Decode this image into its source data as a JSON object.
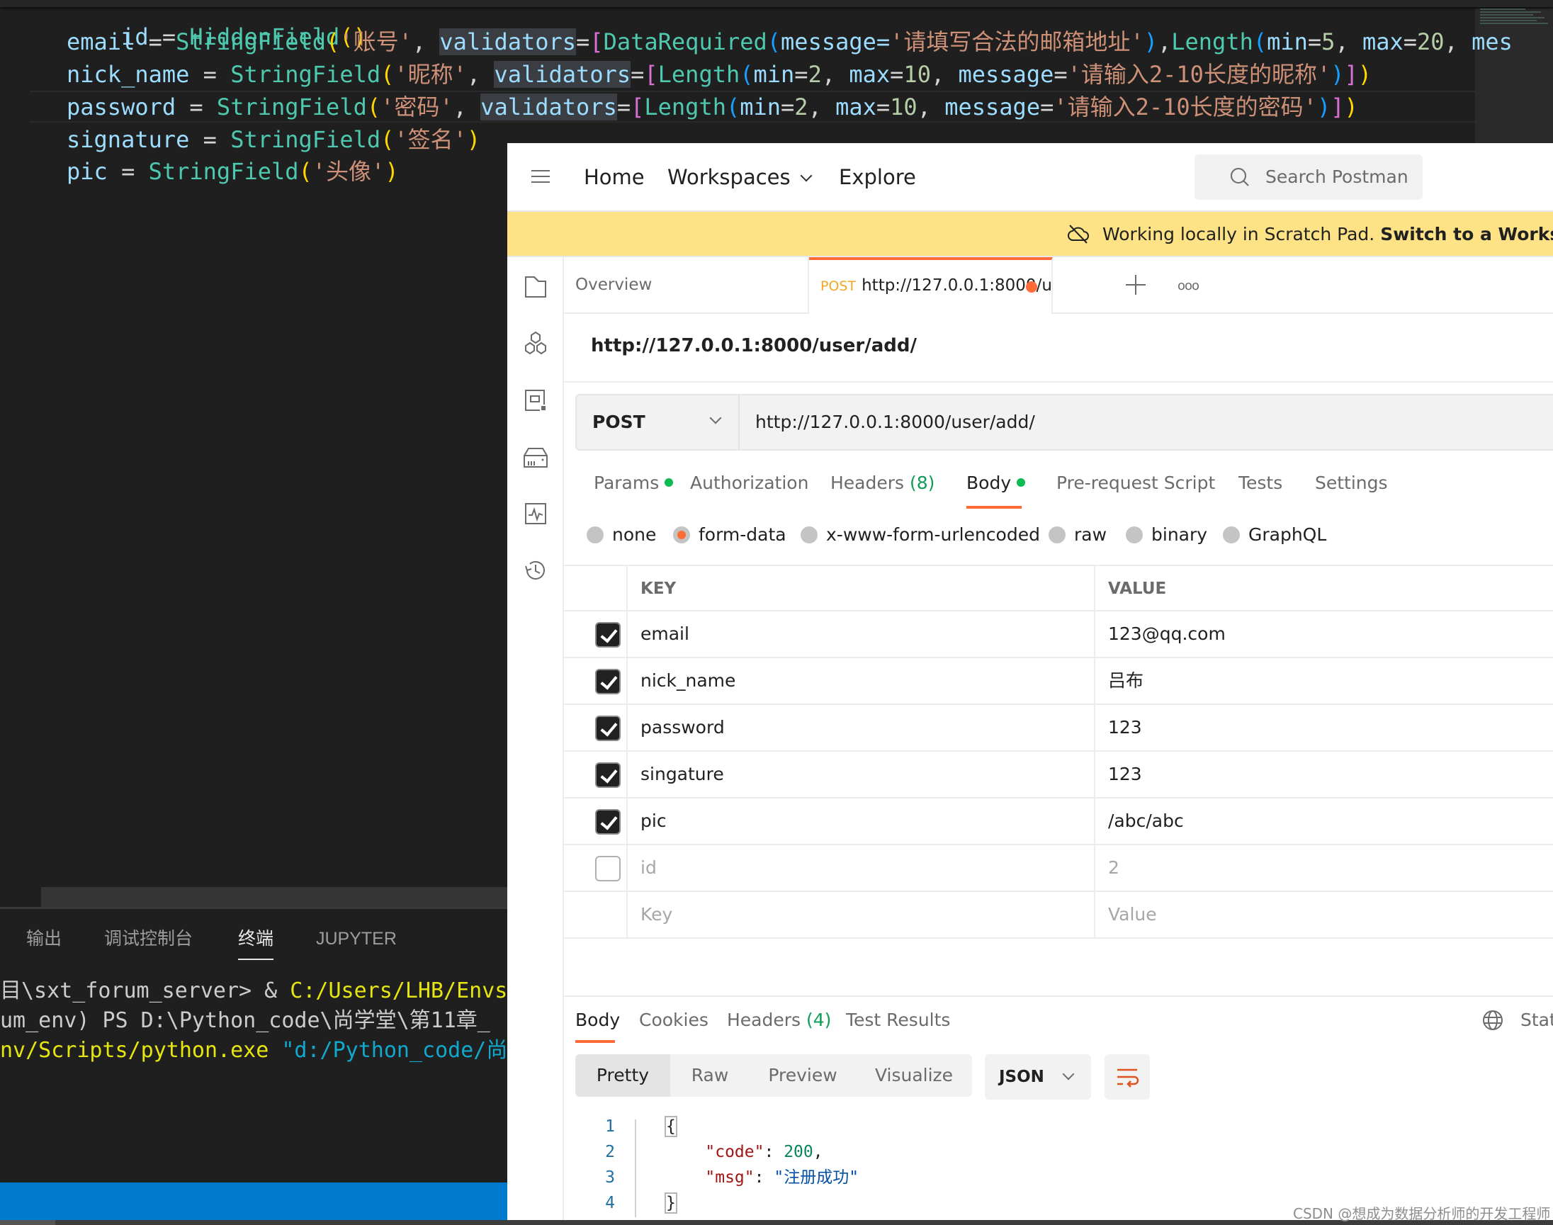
{
  "vscode": {
    "code_lines": [
      {
        "var": "id",
        "op": " = ",
        "cls": "HiddenField",
        "rest": "()"
      },
      {
        "var": "email",
        "cls": "StringField",
        "label": "'账号'",
        "kw": "validators",
        "validators": [
          {
            "cls": "DataRequired",
            "args": "message=",
            "msg": "'请填写合法的邮箱地址'"
          },
          {
            "cls": "Length",
            "min": "5",
            "max": "20",
            "tail": "mes"
          }
        ]
      },
      {
        "var": "nick_name",
        "cls": "StringField",
        "label": "'昵称'",
        "kw": "validators",
        "validators": [
          {
            "cls": "Length",
            "min": "2",
            "max": "10",
            "msg": "'请输入2-10长度的昵称'"
          }
        ]
      },
      {
        "var": "password",
        "cls": "StringField",
        "label": "'密码'",
        "kw": "validators",
        "validators": [
          {
            "cls": "Length",
            "min": "2",
            "max": "10",
            "msg": "'请输入2-10长度的密码'"
          }
        ]
      },
      {
        "var": "signature",
        "cls": "StringField",
        "label": "'签名'"
      },
      {
        "var": "pic",
        "cls": "StringField",
        "label": "'头像'"
      }
    ],
    "panel_tabs": [
      {
        "label": "输出",
        "active": false
      },
      {
        "label": "调试控制台",
        "active": false
      },
      {
        "label": "终端",
        "active": true
      },
      {
        "label": "JUPYTER",
        "active": false
      }
    ],
    "terminal_lines": [
      {
        "plain": "目\\sxt_forum_server> & ",
        "yellow": "C:/Users/LHB/Envs",
        "cyan": ""
      },
      {
        "plain": "um_env) PS D:\\Python_code\\尚学堂\\第11章_",
        "yellow": "",
        "cyan": ""
      },
      {
        "plain": "",
        "yellow": "nv/Scripts/python.exe ",
        "cyan": "\"d:/Python_code/尚"
      }
    ]
  },
  "postman": {
    "nav": {
      "home": "Home",
      "workspaces": "Workspaces",
      "explore": "Explore",
      "search_placeholder": "Search Postman"
    },
    "banner": {
      "text": "Working locally in Scratch Pad.",
      "link": "Switch to a Workspace"
    },
    "sidebar_icons": [
      "collections-icon",
      "apis-icon",
      "environments-icon",
      "mock-servers-icon",
      "monitors-icon",
      "history-icon"
    ],
    "tabs": [
      {
        "label": "Overview",
        "active": false
      },
      {
        "method": "POST",
        "label": "http://127.0.0.1:8000/u",
        "active": true,
        "unsaved": true
      }
    ],
    "request": {
      "title": "http://127.0.0.1:8000/user/add/",
      "method": "POST",
      "url": "http://127.0.0.1:8000/user/add/"
    },
    "request_tabs": [
      {
        "label": "Params",
        "dot": true,
        "active": false
      },
      {
        "label": "Authorization",
        "active": false
      },
      {
        "label": "Headers",
        "count": "(8)",
        "active": false
      },
      {
        "label": "Body",
        "dot": true,
        "active": true
      },
      {
        "label": "Pre-request Script",
        "active": false
      },
      {
        "label": "Tests",
        "active": false
      },
      {
        "label": "Settings",
        "active": false
      }
    ],
    "body_types": [
      {
        "label": "none",
        "selected": false
      },
      {
        "label": "form-data",
        "selected": true
      },
      {
        "label": "x-www-form-urlencoded",
        "selected": false
      },
      {
        "label": "raw",
        "selected": false
      },
      {
        "label": "binary",
        "selected": false
      },
      {
        "label": "GraphQL",
        "selected": false
      }
    ],
    "form_table": {
      "headers": {
        "key": "KEY",
        "value": "VALUE"
      },
      "rows": [
        {
          "checked": true,
          "key": "email",
          "value": "123@qq.com"
        },
        {
          "checked": true,
          "key": "nick_name",
          "value": "吕布"
        },
        {
          "checked": true,
          "key": "password",
          "value": "123"
        },
        {
          "checked": true,
          "key": "singature",
          "value": "123"
        },
        {
          "checked": true,
          "key": "pic",
          "value": "/abc/abc"
        },
        {
          "checked": false,
          "key": "id",
          "value": "2"
        }
      ],
      "placeholder": {
        "key": "Key",
        "value": "Value"
      }
    },
    "response": {
      "tabs": [
        {
          "label": "Body",
          "active": true
        },
        {
          "label": "Cookies",
          "active": false
        },
        {
          "label": "Headers",
          "count": "(4)",
          "active": false
        },
        {
          "label": "Test Results",
          "active": false
        }
      ],
      "status_label": "Statu",
      "views": [
        {
          "label": "Pretty",
          "active": true
        },
        {
          "label": "Raw",
          "active": false
        },
        {
          "label": "Preview",
          "active": false
        },
        {
          "label": "Visualize",
          "active": false
        }
      ],
      "format": "JSON",
      "code": {
        "line_numbers": [
          "1",
          "2",
          "3",
          "4"
        ],
        "open": "{",
        "code_key": "\"code\"",
        "code_val": "200",
        "msg_key": "\"msg\"",
        "msg_val": "\"注册成功\"",
        "close": "}"
      }
    }
  },
  "watermark": "CSDN @想成为数据分析师的开发工程师"
}
